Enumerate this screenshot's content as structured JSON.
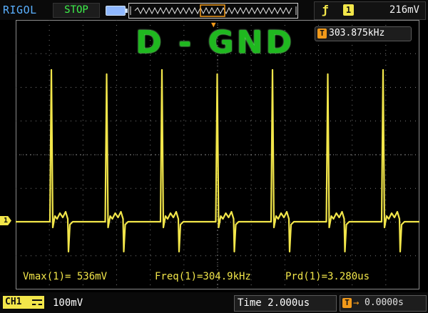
{
  "topbar": {
    "brand": "RIGOL",
    "run_state": "STOP",
    "trigger_channel": "1",
    "trigger_level": "216mV"
  },
  "overlay": {
    "title": "D - GND",
    "frequency_counter": "303.875kHz",
    "t_icon_label": "T"
  },
  "channel_marker": "1",
  "measurements": {
    "vmax": "Vmax(1)= 536mV",
    "freq": "Freq(1)=304.9kHz",
    "prd": "Prd(1)=3.280us"
  },
  "bottombar": {
    "channel_label": "CH1",
    "channel_scale": "100mV",
    "timebase": "Time 2.000us",
    "delay": "0.0000s"
  },
  "colors": {
    "trace": "#f2e64a",
    "title_green": "#1fb81f",
    "run_state": "#3df24a",
    "brand": "#5ab0ff",
    "trigger_marker": "#f29a1a"
  }
}
